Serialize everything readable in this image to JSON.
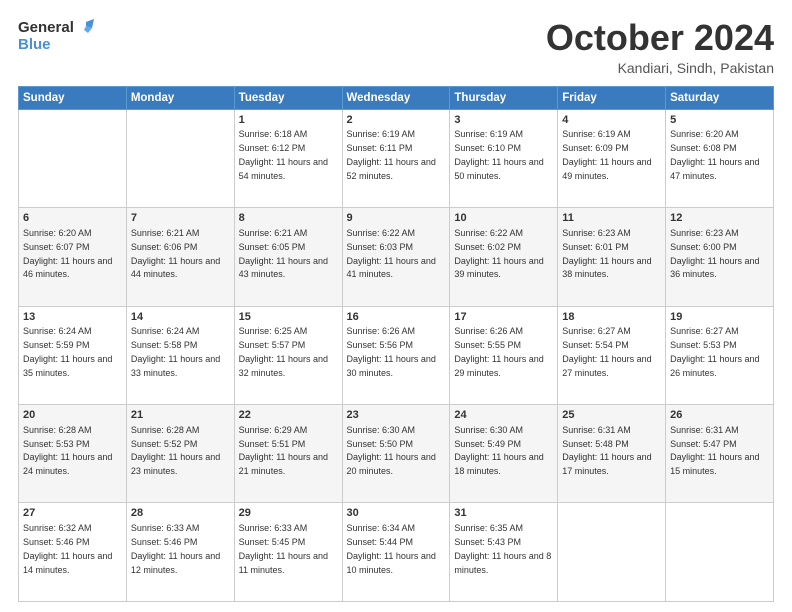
{
  "header": {
    "logo_line1": "General",
    "logo_line2": "Blue",
    "month": "October 2024",
    "location": "Kandiari, Sindh, Pakistan"
  },
  "days_of_week": [
    "Sunday",
    "Monday",
    "Tuesday",
    "Wednesday",
    "Thursday",
    "Friday",
    "Saturday"
  ],
  "weeks": [
    [
      {
        "day": "",
        "text": ""
      },
      {
        "day": "",
        "text": ""
      },
      {
        "day": "1",
        "text": "Sunrise: 6:18 AM\nSunset: 6:12 PM\nDaylight: 11 hours and 54 minutes."
      },
      {
        "day": "2",
        "text": "Sunrise: 6:19 AM\nSunset: 6:11 PM\nDaylight: 11 hours and 52 minutes."
      },
      {
        "day": "3",
        "text": "Sunrise: 6:19 AM\nSunset: 6:10 PM\nDaylight: 11 hours and 50 minutes."
      },
      {
        "day": "4",
        "text": "Sunrise: 6:19 AM\nSunset: 6:09 PM\nDaylight: 11 hours and 49 minutes."
      },
      {
        "day": "5",
        "text": "Sunrise: 6:20 AM\nSunset: 6:08 PM\nDaylight: 11 hours and 47 minutes."
      }
    ],
    [
      {
        "day": "6",
        "text": "Sunrise: 6:20 AM\nSunset: 6:07 PM\nDaylight: 11 hours and 46 minutes."
      },
      {
        "day": "7",
        "text": "Sunrise: 6:21 AM\nSunset: 6:06 PM\nDaylight: 11 hours and 44 minutes."
      },
      {
        "day": "8",
        "text": "Sunrise: 6:21 AM\nSunset: 6:05 PM\nDaylight: 11 hours and 43 minutes."
      },
      {
        "day": "9",
        "text": "Sunrise: 6:22 AM\nSunset: 6:03 PM\nDaylight: 11 hours and 41 minutes."
      },
      {
        "day": "10",
        "text": "Sunrise: 6:22 AM\nSunset: 6:02 PM\nDaylight: 11 hours and 39 minutes."
      },
      {
        "day": "11",
        "text": "Sunrise: 6:23 AM\nSunset: 6:01 PM\nDaylight: 11 hours and 38 minutes."
      },
      {
        "day": "12",
        "text": "Sunrise: 6:23 AM\nSunset: 6:00 PM\nDaylight: 11 hours and 36 minutes."
      }
    ],
    [
      {
        "day": "13",
        "text": "Sunrise: 6:24 AM\nSunset: 5:59 PM\nDaylight: 11 hours and 35 minutes."
      },
      {
        "day": "14",
        "text": "Sunrise: 6:24 AM\nSunset: 5:58 PM\nDaylight: 11 hours and 33 minutes."
      },
      {
        "day": "15",
        "text": "Sunrise: 6:25 AM\nSunset: 5:57 PM\nDaylight: 11 hours and 32 minutes."
      },
      {
        "day": "16",
        "text": "Sunrise: 6:26 AM\nSunset: 5:56 PM\nDaylight: 11 hours and 30 minutes."
      },
      {
        "day": "17",
        "text": "Sunrise: 6:26 AM\nSunset: 5:55 PM\nDaylight: 11 hours and 29 minutes."
      },
      {
        "day": "18",
        "text": "Sunrise: 6:27 AM\nSunset: 5:54 PM\nDaylight: 11 hours and 27 minutes."
      },
      {
        "day": "19",
        "text": "Sunrise: 6:27 AM\nSunset: 5:53 PM\nDaylight: 11 hours and 26 minutes."
      }
    ],
    [
      {
        "day": "20",
        "text": "Sunrise: 6:28 AM\nSunset: 5:53 PM\nDaylight: 11 hours and 24 minutes."
      },
      {
        "day": "21",
        "text": "Sunrise: 6:28 AM\nSunset: 5:52 PM\nDaylight: 11 hours and 23 minutes."
      },
      {
        "day": "22",
        "text": "Sunrise: 6:29 AM\nSunset: 5:51 PM\nDaylight: 11 hours and 21 minutes."
      },
      {
        "day": "23",
        "text": "Sunrise: 6:30 AM\nSunset: 5:50 PM\nDaylight: 11 hours and 20 minutes."
      },
      {
        "day": "24",
        "text": "Sunrise: 6:30 AM\nSunset: 5:49 PM\nDaylight: 11 hours and 18 minutes."
      },
      {
        "day": "25",
        "text": "Sunrise: 6:31 AM\nSunset: 5:48 PM\nDaylight: 11 hours and 17 minutes."
      },
      {
        "day": "26",
        "text": "Sunrise: 6:31 AM\nSunset: 5:47 PM\nDaylight: 11 hours and 15 minutes."
      }
    ],
    [
      {
        "day": "27",
        "text": "Sunrise: 6:32 AM\nSunset: 5:46 PM\nDaylight: 11 hours and 14 minutes."
      },
      {
        "day": "28",
        "text": "Sunrise: 6:33 AM\nSunset: 5:46 PM\nDaylight: 11 hours and 12 minutes."
      },
      {
        "day": "29",
        "text": "Sunrise: 6:33 AM\nSunset: 5:45 PM\nDaylight: 11 hours and 11 minutes."
      },
      {
        "day": "30",
        "text": "Sunrise: 6:34 AM\nSunset: 5:44 PM\nDaylight: 11 hours and 10 minutes."
      },
      {
        "day": "31",
        "text": "Sunrise: 6:35 AM\nSunset: 5:43 PM\nDaylight: 11 hours and 8 minutes."
      },
      {
        "day": "",
        "text": ""
      },
      {
        "day": "",
        "text": ""
      }
    ]
  ]
}
